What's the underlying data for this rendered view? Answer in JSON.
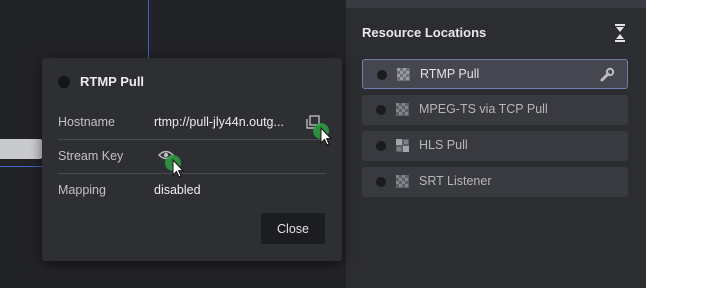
{
  "panel": {
    "title": "Resource Locations",
    "icons": {
      "collapse": "collapse-vertical-icon"
    },
    "items": [
      {
        "label": "RTMP Pull",
        "icon": "checker-icon",
        "selected": true,
        "tool_icon": "wrench-icon"
      },
      {
        "label": "MPEG-TS via TCP Pull",
        "icon": "checker-icon",
        "selected": false
      },
      {
        "label": "HLS Pull",
        "icon": "checker-alt-icon",
        "selected": false
      },
      {
        "label": "SRT Listener",
        "icon": "checker-icon",
        "selected": false
      }
    ]
  },
  "modal": {
    "title": "RTMP Pull",
    "fields": [
      {
        "label": "Hostname",
        "value": "rtmp://pull-jly44n.outg...",
        "icon": "copy-icon"
      },
      {
        "label": "Stream Key",
        "value": "",
        "icon": "eye-icon"
      },
      {
        "label": "Mapping",
        "value": "disabled"
      }
    ],
    "close_label": "Close"
  },
  "colors": {
    "canvas_bg": "#222326",
    "panel_bg": "#2c2d31",
    "modal_bg": "#2e2f33",
    "selection_border": "#6c7fae",
    "connector_blue": "#3d63c9",
    "cursor_highlight": "#2f9e44"
  }
}
